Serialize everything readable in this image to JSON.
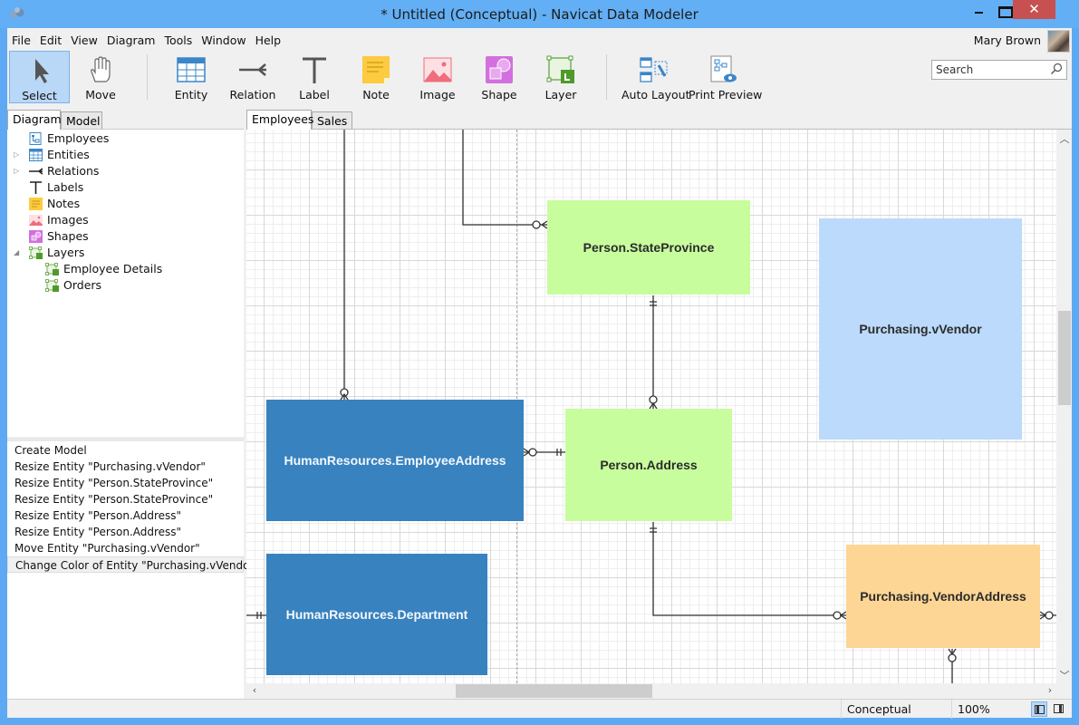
{
  "window": {
    "title": "* Untitled (Conceptual) - Navicat Data Modeler",
    "close_glyph": "✕"
  },
  "menu": [
    "File",
    "Edit",
    "View",
    "Diagram",
    "Tools",
    "Window",
    "Help"
  ],
  "user": {
    "name": "Mary Brown"
  },
  "search": {
    "placeholder": "Search",
    "value": ""
  },
  "toolbar": {
    "tools": [
      {
        "id": "select",
        "label": "Select",
        "icon": "cursor-icon",
        "active": true
      },
      {
        "id": "move",
        "label": "Move",
        "icon": "hand-icon",
        "active": false
      },
      {
        "id": "entity",
        "label": "Entity",
        "icon": "table-icon",
        "active": false
      },
      {
        "id": "relation",
        "label": "Relation",
        "icon": "relation-icon",
        "active": false
      },
      {
        "id": "label",
        "label": "Label",
        "icon": "text-icon",
        "active": false
      },
      {
        "id": "note",
        "label": "Note",
        "icon": "note-icon",
        "active": false
      },
      {
        "id": "image",
        "label": "Image",
        "icon": "image-icon",
        "active": false
      },
      {
        "id": "shape",
        "label": "Shape",
        "icon": "shape-icon",
        "active": false
      },
      {
        "id": "layer",
        "label": "Layer",
        "icon": "layer-icon",
        "active": false
      },
      {
        "id": "auto-layout",
        "label": "Auto Layout",
        "icon": "auto-layout-icon",
        "active": false
      },
      {
        "id": "print-preview",
        "label": "Print Preview",
        "icon": "print-preview-icon",
        "active": false
      }
    ]
  },
  "left_panel": {
    "tabs": [
      {
        "label": "Diagram",
        "active": true
      },
      {
        "label": "Model",
        "active": false
      }
    ],
    "tree": [
      {
        "label": "Employees",
        "icon": "diagram-icon",
        "expander": ""
      },
      {
        "label": "Entities",
        "icon": "table-icon",
        "expander": "collapsed"
      },
      {
        "label": "Relations",
        "icon": "relation-icon",
        "expander": "collapsed"
      },
      {
        "label": "Labels",
        "icon": "text-icon",
        "expander": ""
      },
      {
        "label": "Notes",
        "icon": "note-icon",
        "expander": ""
      },
      {
        "label": "Images",
        "icon": "image-icon",
        "expander": ""
      },
      {
        "label": "Shapes",
        "icon": "shape-icon",
        "expander": ""
      },
      {
        "label": "Layers",
        "icon": "layer-icon",
        "expander": "expanded"
      },
      {
        "label": "Employee Details",
        "icon": "layer-icon",
        "expander": "",
        "child": true
      },
      {
        "label": "Orders",
        "icon": "layer-icon",
        "expander": "",
        "child": true
      }
    ],
    "history": [
      {
        "label": "Create Model"
      },
      {
        "label": "Resize Entity \"Purchasing.vVendor\""
      },
      {
        "label": "Resize Entity \"Person.StateProvince\""
      },
      {
        "label": "Resize Entity \"Person.StateProvince\""
      },
      {
        "label": "Resize Entity \"Person.Address\""
      },
      {
        "label": "Resize Entity \"Person.Address\""
      },
      {
        "label": "Move Entity \"Purchasing.vVendor\""
      },
      {
        "label": "Change Color of Entity \"Purchasing.vVendor\"",
        "selected": true
      }
    ]
  },
  "canvas": {
    "tabs": [
      {
        "label": "Employees",
        "active": true
      },
      {
        "label": "Sales",
        "active": false
      }
    ],
    "entities": [
      {
        "id": "state-province",
        "name": "Person.StateProvince",
        "color": "#c8fd9e",
        "theme": "light"
      },
      {
        "id": "vvendor",
        "name": "Purchasing.vVendor",
        "color": "#bcdafb",
        "theme": "light"
      },
      {
        "id": "employee-address",
        "name": "HumanResources.EmployeeAddress",
        "color": "#3782bf",
        "theme": "dark"
      },
      {
        "id": "address",
        "name": "Person.Address",
        "color": "#c8fd9e",
        "theme": "light"
      },
      {
        "id": "department",
        "name": "HumanResources.Department",
        "color": "#3782bf",
        "theme": "dark"
      },
      {
        "id": "vendor-address",
        "name": "Purchasing.VendorAddress",
        "color": "#fdd594",
        "theme": "light"
      }
    ]
  },
  "status": {
    "model_type": "Conceptual",
    "zoom": "100%"
  }
}
